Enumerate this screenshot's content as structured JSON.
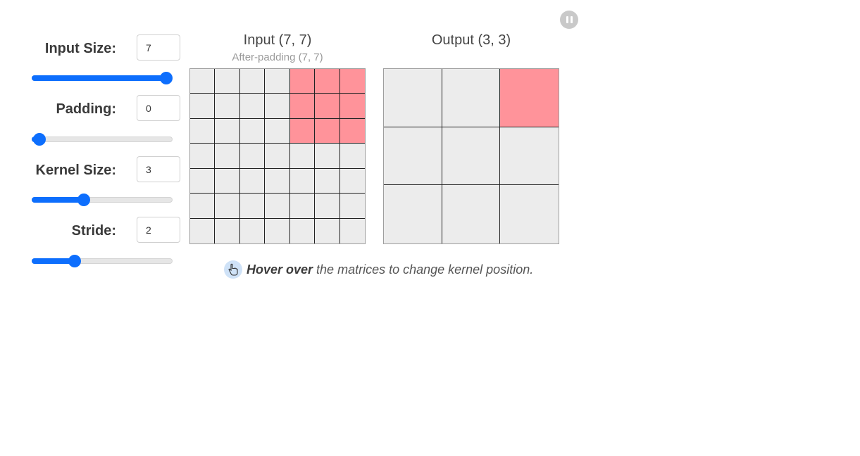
{
  "controls": {
    "input_size": {
      "label": "Input Size:",
      "value": "7",
      "slider_fraction": 1.0
    },
    "padding": {
      "label": "Padding:",
      "value": "0",
      "slider_fraction": 0.0
    },
    "kernel_size": {
      "label": "Kernel Size:",
      "value": "3",
      "slider_fraction": 0.35
    },
    "stride": {
      "label": "Stride:",
      "value": "2",
      "slider_fraction": 0.28
    }
  },
  "input_matrix": {
    "title": "Input (7, 7)",
    "subtitle": "After-padding (7, 7)",
    "rows": 7,
    "cols": 7,
    "highlight": {
      "row_start": 0,
      "row_end": 2,
      "col_start": 4,
      "col_end": 6
    }
  },
  "output_matrix": {
    "title": "Output (3, 3)",
    "rows": 3,
    "cols": 3,
    "highlight": {
      "row": 0,
      "col": 2
    }
  },
  "hint": {
    "emphasis": "Hover over",
    "text": "the matrices to change kernel position."
  },
  "icons": {
    "pause": "pause-icon",
    "hint": "hand-pointer-icon"
  },
  "colors": {
    "accent": "#0d6efd",
    "highlight": "#ff939a",
    "cell": "#ececec"
  }
}
